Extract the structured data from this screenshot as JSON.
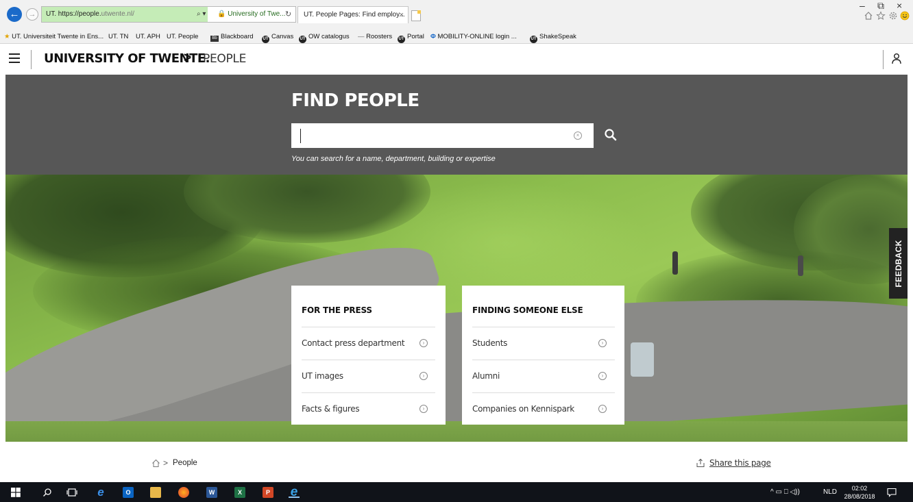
{
  "browser": {
    "address_url_prefix": "UT. https://people.",
    "address_url_domain": "utwente.nl/",
    "address_tools": "⌕ ▾",
    "address_org": "🔒 University of Twe...",
    "refresh": "↻",
    "tab_title": "UT. People Pages: Find employ...",
    "tab_close": "×",
    "back": "←",
    "forward": "→",
    "window_minimize": "–",
    "window_restore": "⧉",
    "window_close": "×",
    "toolbar_icons": [
      "home-icon",
      "favorites-star-icon",
      "settings-gear-icon",
      "smiley-feedback-icon"
    ]
  },
  "favorites": [
    {
      "label": "UT. Universiteit Twente in Ens...",
      "icon": "star-folder-icon"
    },
    {
      "label": "UT. TN",
      "icon": ""
    },
    {
      "label": "UT. APH",
      "icon": ""
    },
    {
      "label": "UT. People",
      "icon": ""
    },
    {
      "label": "Blackboard",
      "icon": "bb-icon"
    },
    {
      "label": "Canvas",
      "icon": "ut-badge-icon"
    },
    {
      "label": "OW catalogus",
      "icon": "ut-badge-icon"
    },
    {
      "label": "Roosters",
      "icon": "dash-icon"
    },
    {
      "label": "Portal",
      "icon": "ut-badge-icon"
    },
    {
      "label": "MOBILITY-ONLINE login ...",
      "icon": "mobility-icon"
    },
    {
      "label": "ShakeSpeak",
      "icon": "ut-badge-icon"
    }
  ],
  "header": {
    "brand": "UNIVERSITY OF TWENTE.",
    "separator": ">",
    "section": "PEOPLE"
  },
  "search": {
    "title": "FIND PEOPLE",
    "value": "",
    "placeholder": "",
    "hint": "You can search for a name, department, building or expertise"
  },
  "feedback_label": "FEEDBACK",
  "cards": [
    {
      "title": "FOR THE PRESS",
      "links": [
        "Contact press department",
        "UT images",
        "Facts & figures"
      ]
    },
    {
      "title": "FINDING SOMEONE ELSE",
      "links": [
        "Students",
        "Alumni",
        "Companies on Kennispark"
      ]
    }
  ],
  "breadcrumb": {
    "separator": ">",
    "current": "People"
  },
  "share_label": "Share this page",
  "taskbar": {
    "language": "NLD",
    "time": "02:02",
    "date": "28/08/2018",
    "tray_icons": "^ ▭ ⎕ ◁))",
    "apps": [
      "windows-start-icon",
      "search-icon",
      "task-view-icon",
      "edge-icon",
      "outlook-icon",
      "file-explorer-icon",
      "firefox-icon",
      "word-icon",
      "excel-icon",
      "powerpoint-icon",
      "internet-explorer-icon"
    ]
  },
  "colors": {
    "band": "#575757",
    "grass": "#8cbd4d",
    "accent_blue": "#1b6ac9"
  }
}
